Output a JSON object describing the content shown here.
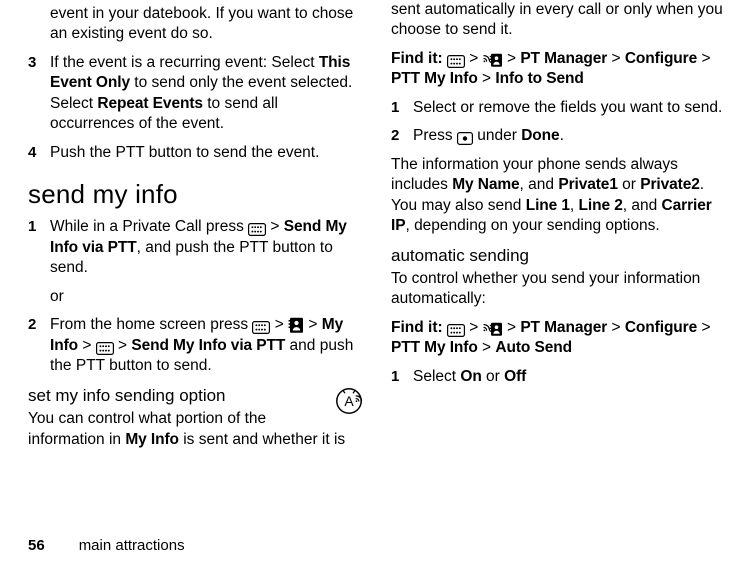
{
  "footer": {
    "page_number": "56",
    "section": "main attractions"
  },
  "left": {
    "intro": "event in your datebook. If you want to chose an existing event do so.",
    "step3": {
      "num": "3",
      "pre": "If the event is a recurring event: Select ",
      "label1": "This Event Only",
      "mid": " to send only the event selected. Select ",
      "label2": "Repeat Events",
      "post": " to send all occurrences of the event."
    },
    "step4": {
      "num": "4",
      "text": "Push the PTT button to send the event."
    },
    "h1": "send my info",
    "smi_step1": {
      "num": "1",
      "pre": "While in a Private Call press ",
      "gt1": " > ",
      "label": "Send My Info via PTT",
      "post": ", and push the PTT button to send."
    },
    "or": "or",
    "smi_step2": {
      "num": "2",
      "pre": "From the home screen press ",
      "gt1": " > ",
      "gt2": " > ",
      "label_myinfo": "My Info",
      "gt3": " > ",
      "gt4": " > ",
      "label_send": "Send My Info via PTT",
      "post": " and push the PTT button to send."
    },
    "h2": "set my info sending option",
    "opt_para": {
      "pre": "You can control what portion of the information in ",
      "label": "My Info",
      "post": " is sent and whether it is "
    }
  },
  "right": {
    "cont": "sent automatically in every call or only when you choose to send it.",
    "find1": {
      "label": "Find it:",
      "gt1": " > ",
      "gt2": " > ",
      "l1": "PT Manager",
      "gt3": " > ",
      "l2": "Configure",
      "gt4": " > ",
      "l3": "PTT My Info",
      "gt5": " > ",
      "l4": "Info to Send"
    },
    "r_step1": {
      "num": "1",
      "text": "Select or remove the fields you want to send."
    },
    "r_step2": {
      "num": "2",
      "pre": "Press ",
      "mid": " under ",
      "done": "Done",
      "post": "."
    },
    "info_para": {
      "t1": "The information your phone sends always includes ",
      "myname": "My Name",
      "t2": ", and ",
      "p1": "Private1",
      "t3": " or ",
      "p2": "Private2",
      "t4": ". You may also send ",
      "l1": "Line 1",
      "t5": ", ",
      "l2": "Line 2",
      "t6": ", and ",
      "cip": "Carrier IP",
      "t7": ", depending on your sending options."
    },
    "h2": "automatic sending",
    "auto_para": "To control whether you send your information automatically:",
    "find2": {
      "label": "Find it:",
      "gt1": " > ",
      "gt2": " > ",
      "l1": "PT Manager",
      "gt3": " > ",
      "l2": "Configure",
      "gt4": " > ",
      "l3": "PTT My Info",
      "gt5": " > ",
      "l4": "Auto Send"
    },
    "a_step1": {
      "num": "1",
      "pre": "Select ",
      "on": "On",
      "mid": " or ",
      "off": "Off"
    }
  }
}
